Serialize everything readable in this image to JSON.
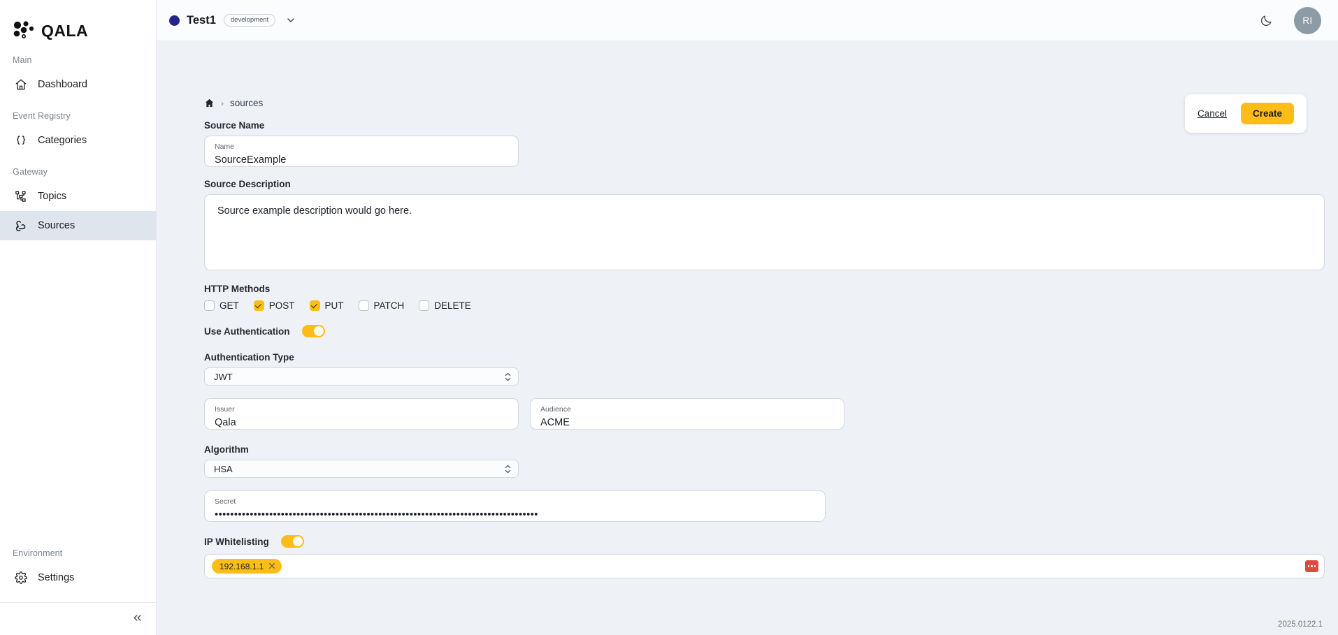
{
  "brand": {
    "name": "QALA",
    "logo_icon": "qala-logo-icon"
  },
  "sidebar": {
    "sections": [
      {
        "title": "Main",
        "items": [
          {
            "label": "Dashboard",
            "icon": "home-icon",
            "active": false
          }
        ]
      },
      {
        "title": "Event Registry",
        "items": [
          {
            "label": "Categories",
            "icon": "braces-icon",
            "active": false
          }
        ]
      },
      {
        "title": "Gateway",
        "items": [
          {
            "label": "Topics",
            "icon": "topics-icon",
            "active": false
          },
          {
            "label": "Sources",
            "icon": "webhook-icon",
            "active": true
          }
        ]
      },
      {
        "title": "Environment",
        "items": [
          {
            "label": "Settings",
            "icon": "gear-icon",
            "active": false
          }
        ]
      }
    ],
    "collapse_icon": "chevrons-left-icon"
  },
  "topbar": {
    "project_name": "Test1",
    "environment_badge": "development",
    "project_dot_color": "#26248c",
    "chevron_icon": "chevron-down-icon",
    "theme_toggle_icon": "moon-icon",
    "avatar_initials": "RI"
  },
  "breadcrumb": {
    "home_icon": "home-icon",
    "separator": "›",
    "current": "sources"
  },
  "actions": {
    "cancel_label": "Cancel",
    "create_label": "Create",
    "accent_color": "#fcbd17"
  },
  "form": {
    "source_name": {
      "section_label": "Source Name",
      "field_label": "Name",
      "value": "SourceExample"
    },
    "source_description": {
      "section_label": "Source Description",
      "value": "Source example description would go here."
    },
    "http_methods": {
      "section_label": "HTTP Methods",
      "options": [
        {
          "label": "GET",
          "checked": false
        },
        {
          "label": "POST",
          "checked": true
        },
        {
          "label": "PUT",
          "checked": true
        },
        {
          "label": "PATCH",
          "checked": false
        },
        {
          "label": "DELETE",
          "checked": false
        }
      ]
    },
    "use_authentication": {
      "label": "Use Authentication",
      "enabled": true
    },
    "authentication_type": {
      "section_label": "Authentication Type",
      "value": "JWT"
    },
    "issuer": {
      "field_label": "Issuer",
      "value": "Qala"
    },
    "audience": {
      "field_label": "Audience",
      "value": "ACME"
    },
    "algorithm": {
      "section_label": "Algorithm",
      "value": "HSA"
    },
    "secret": {
      "field_label": "Secret",
      "value": "•••••••••••••••••••••••••••••••••••••••••••••••••••••••••••••••••••••••••••••••••••"
    },
    "ip_whitelisting": {
      "label": "IP Whitelisting",
      "enabled": true,
      "chips": [
        {
          "value": "192.168.1.1",
          "remove_icon": "close-icon"
        }
      ],
      "clear_button_icon": "ellipsis-icon",
      "clear_button_color": "#de4a40"
    }
  },
  "footer": {
    "version": "2025.0122.1"
  }
}
